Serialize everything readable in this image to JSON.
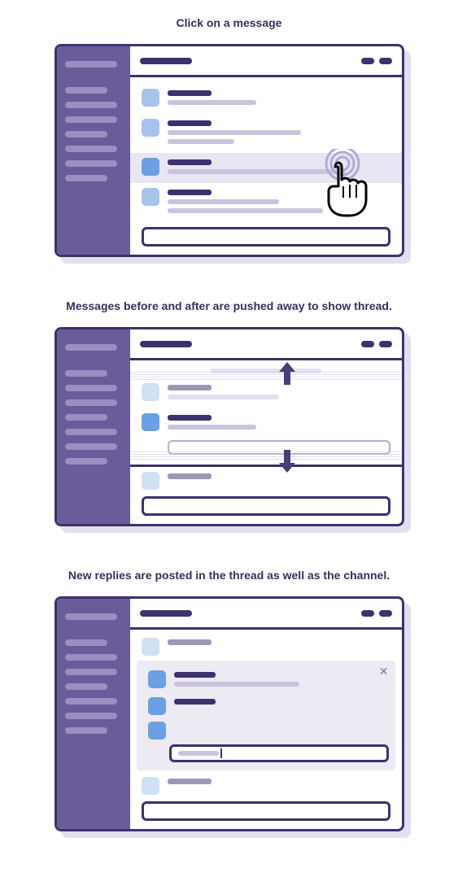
{
  "sections": [
    {
      "caption": "Click on a message"
    },
    {
      "caption": "Messages before and after are pushed away to show thread."
    },
    {
      "caption": "New replies are posted in the thread as well as the channel."
    }
  ]
}
